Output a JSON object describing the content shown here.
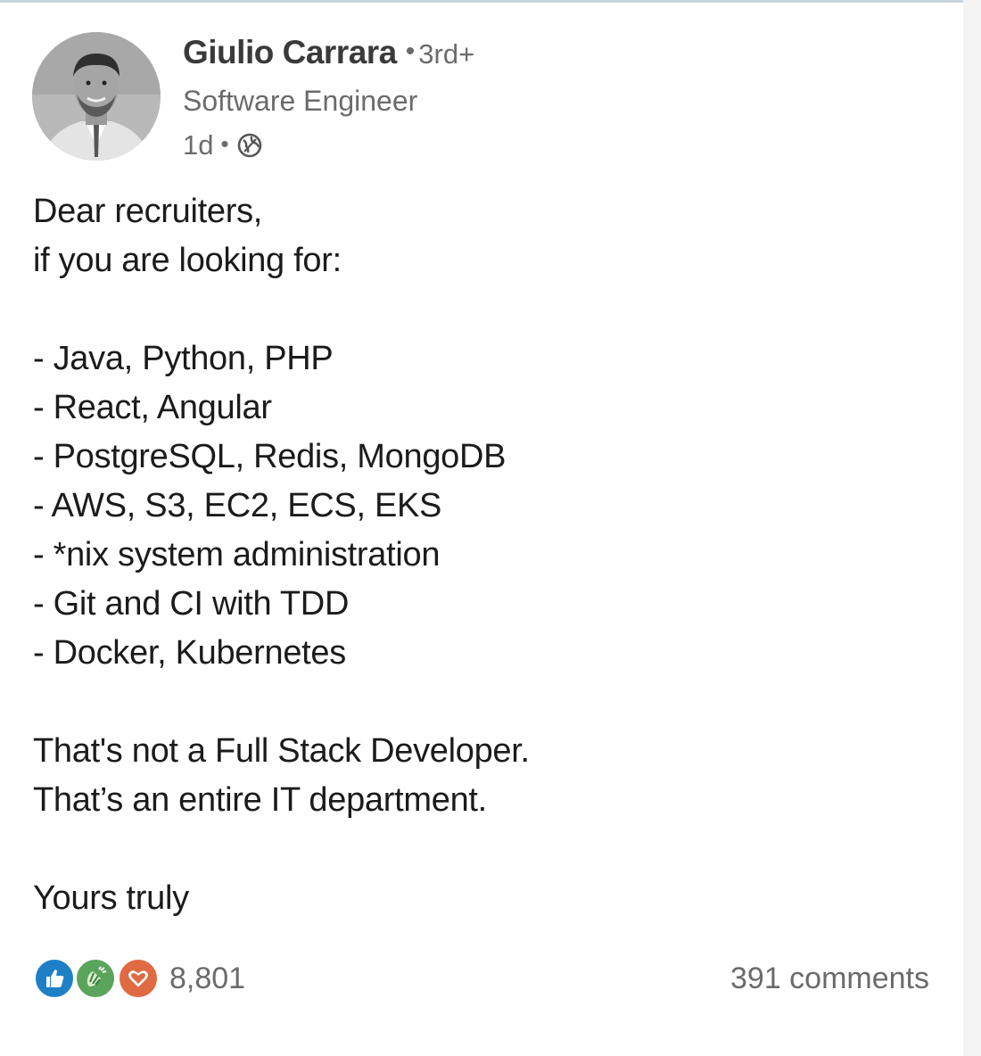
{
  "post": {
    "author": {
      "name": "Giulio Carrara",
      "separator": "•",
      "connection_degree": "3rd+",
      "headline": "Software Engineer",
      "posted_ago": "1d",
      "meta_separator": "•",
      "visibility_icon": "globe-icon"
    },
    "body_lines": [
      "Dear recruiters,",
      "if you are looking for:",
      "",
      "- Java, Python, PHP",
      "- React, Angular",
      "- PostgreSQL, Redis, MongoDB",
      "- AWS, S3, EC2, ECS, EKS",
      "- *nix system administration",
      "- Git and CI with TDD",
      "- Docker, Kubernetes",
      "",
      "That's not a Full Stack Developer.",
      "That’s an entire IT department.",
      "",
      "Yours truly"
    ],
    "social": {
      "reaction_icons": [
        "like-icon",
        "celebrate-icon",
        "love-icon"
      ],
      "reaction_colors": {
        "like": "#1f7fc6",
        "celebrate": "#5aa45b",
        "love": "#e06a43"
      },
      "reaction_count": "8,801",
      "comments": "391 comments"
    }
  }
}
